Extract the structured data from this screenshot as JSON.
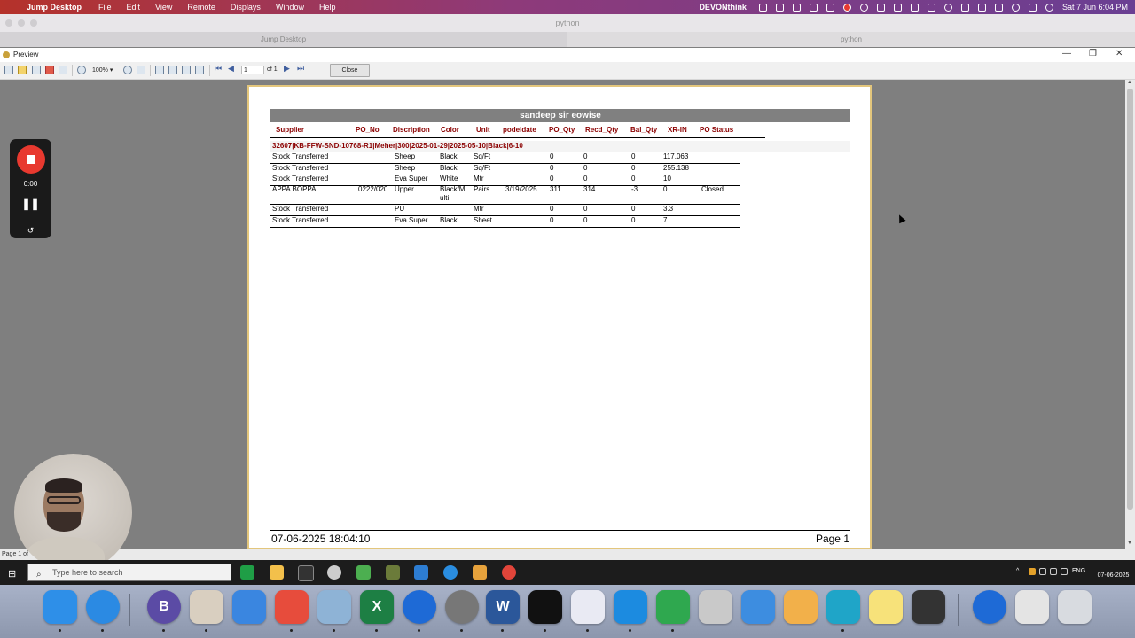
{
  "menubar": {
    "app": "Jump Desktop",
    "items": [
      "File",
      "Edit",
      "View",
      "Remote",
      "Displays",
      "Window",
      "Help"
    ],
    "right_app": "DEVONthink",
    "datetime": "Sat 7 Jun  6:04 PM"
  },
  "jump": {
    "window_title": "python",
    "tabs": [
      "Jump Desktop",
      "python"
    ]
  },
  "preview": {
    "title": "Preview",
    "toolbar": {
      "zoom": "100%",
      "page_input": "1",
      "page_of": "of 1",
      "close_label": "Close"
    },
    "status": "Page 1 of"
  },
  "report": {
    "title": "sandeep sir eowise",
    "columns": [
      "Supplier",
      "PO_No",
      "Discription",
      "Color",
      "Unit",
      "podeldate",
      "PO_Qty",
      "Recd_Qty",
      "Bal_Qty",
      "XR-IN",
      "PO Status"
    ],
    "group": "32607|KB-FFW-SND-10768-R1|Meher|300|2025-01-29|2025-05-10|Black|6-10",
    "rows": [
      {
        "supplier": "Stock Transferred",
        "po_no": "",
        "desc": "Sheep",
        "color": "Black",
        "unit": "Sq/Ft",
        "podeldate": "",
        "po_qty": "0",
        "recd_qty": "0",
        "bal_qty": "0",
        "xr_in": "117.063",
        "status": ""
      },
      {
        "supplier": "Stock Transferred",
        "po_no": "",
        "desc": "Sheep",
        "color": "Black",
        "unit": "Sq/Ft",
        "podeldate": "",
        "po_qty": "0",
        "recd_qty": "0",
        "bal_qty": "0",
        "xr_in": "255.138",
        "status": ""
      },
      {
        "supplier": "Stock Transferred",
        "po_no": "",
        "desc": "Eva Super",
        "color": "White",
        "unit": "Mtr",
        "podeldate": "",
        "po_qty": "0",
        "recd_qty": "0",
        "bal_qty": "0",
        "xr_in": "10",
        "status": ""
      },
      {
        "supplier": "APPA BOPPA",
        "po_no": "0222/020",
        "desc": "Upper",
        "color": "Black/M",
        "color2": "ulti",
        "unit": "Pairs",
        "podeldate": "3/19/2025",
        "po_qty": "311",
        "recd_qty": "314",
        "bal_qty": "-3",
        "xr_in": "0",
        "status": "Closed"
      },
      {
        "supplier": "Stock Transferred",
        "po_no": "",
        "desc": "PU",
        "color": "",
        "unit": "Mtr",
        "podeldate": "",
        "po_qty": "0",
        "recd_qty": "0",
        "bal_qty": "0",
        "xr_in": "3.3",
        "status": ""
      },
      {
        "supplier": "Stock Transferred",
        "po_no": "",
        "desc": "Eva Super",
        "color": "Black",
        "unit": "Sheet",
        "podeldate": "",
        "po_qty": "0",
        "recd_qty": "0",
        "bal_qty": "0",
        "xr_in": "7",
        "status": ""
      }
    ],
    "footer_datetime": "07-06-2025 18:04:10",
    "footer_page": "Page 1"
  },
  "recorder": {
    "time": "0:00"
  },
  "windows_taskbar": {
    "search_placeholder": "Type here to search",
    "lang": "ENG",
    "date": "07-06-2025"
  },
  "colors": {
    "header_text": "#8b0000",
    "title_bar": "#808080",
    "page_border": "#e3c67c"
  }
}
